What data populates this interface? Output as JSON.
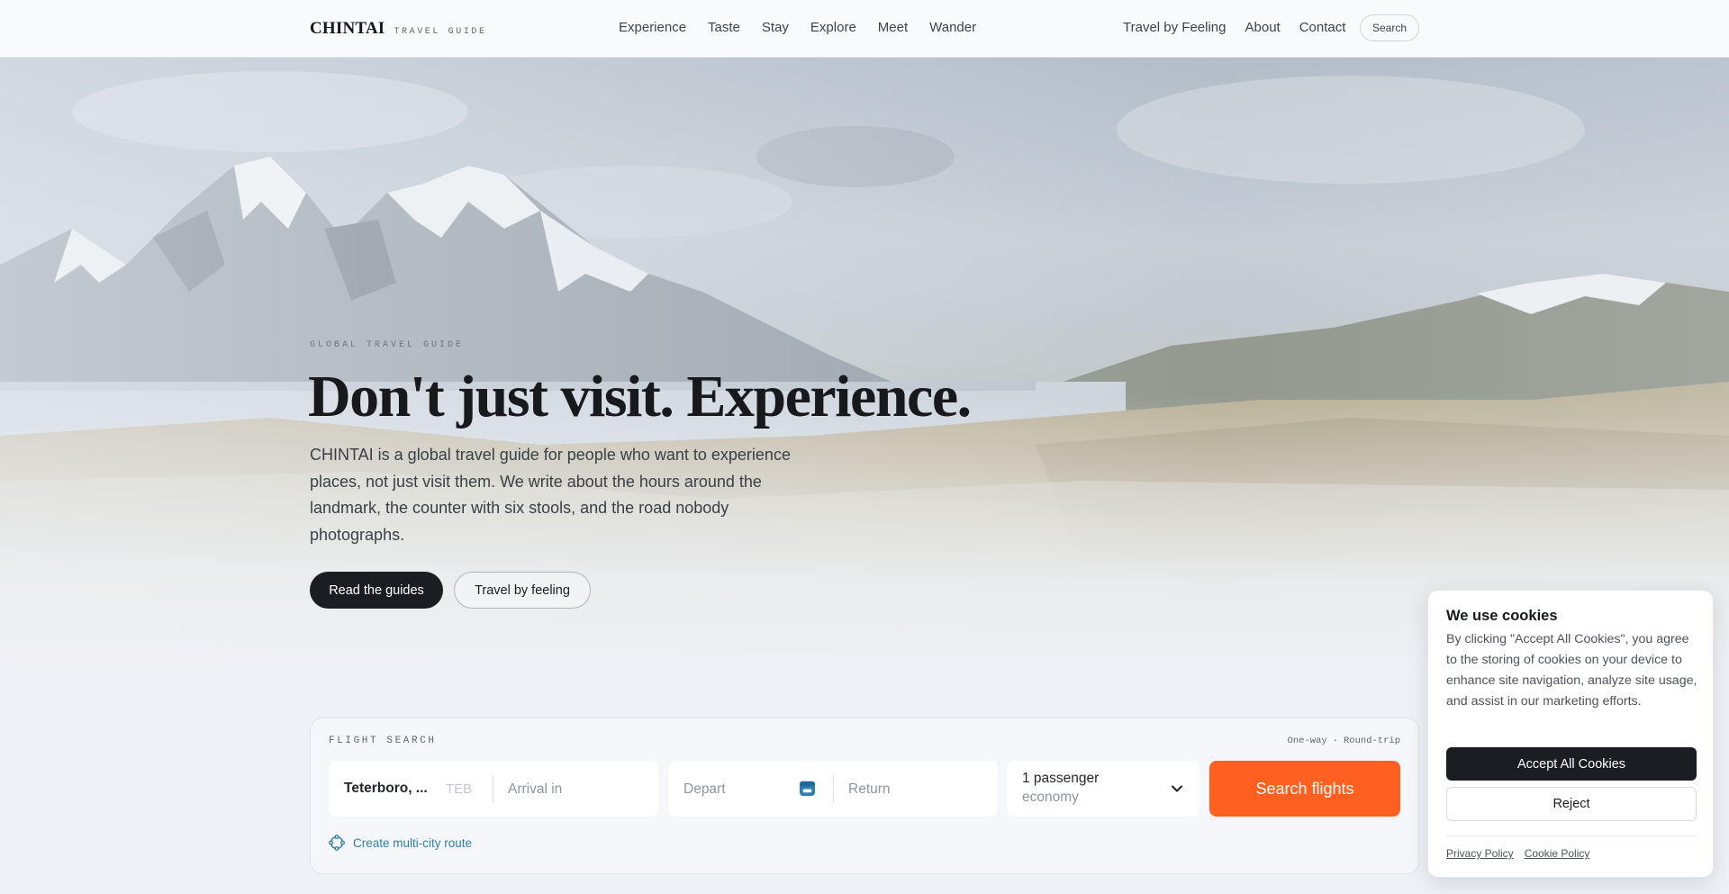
{
  "header": {
    "brand_name": "CHINTAI",
    "brand_tag": "TRAVEL GUIDE",
    "nav_main": [
      "Experience",
      "Taste",
      "Stay",
      "Explore",
      "Meet",
      "Wander"
    ],
    "nav_right": [
      "Travel by Feeling",
      "About",
      "Contact"
    ],
    "search_label": "Search"
  },
  "hero": {
    "eyebrow": "GLOBAL TRAVEL GUIDE",
    "headline": "Don't just visit. Experience.",
    "lead": "CHINTAI is a global travel guide for people who want to experience places, not just visit them. We write about the hours around the landmark, the counter with six stools, and the road nobody photographs.",
    "primary_button": "Read the guides",
    "secondary_button": "Travel by feeling"
  },
  "flight_search": {
    "label": "FLIGHT SEARCH",
    "trip_types": [
      "One-way",
      "·",
      "Round-trip"
    ],
    "from_value": "Teterboro, ...",
    "from_code": "TEB",
    "to_placeholder": "Arrival in",
    "depart_placeholder": "Depart",
    "return_placeholder": "Return",
    "passengers": "1 passenger",
    "cabin_class": "economy",
    "search_button": "Search flights",
    "multi_city": "Create multi-city route",
    "icons": {
      "calendar": "calendar-icon",
      "chevron": "chevron-down-icon",
      "multi_city": "route-icon"
    }
  },
  "cookie_banner": {
    "title": "We use cookies",
    "body": "By clicking \"Accept All Cookies\", you agree to the storing of cookies on your device to enhance site navigation, analyze site usage, and assist in our marketing efforts.",
    "accept": "Accept All Cookies",
    "reject": "Reject",
    "links": [
      "Privacy Policy",
      "Cookie Policy"
    ]
  },
  "colors": {
    "accent": "#ff5f1f",
    "dark": "#1b1d22",
    "link": "#2f7fb3",
    "background": "#eef1f5"
  }
}
